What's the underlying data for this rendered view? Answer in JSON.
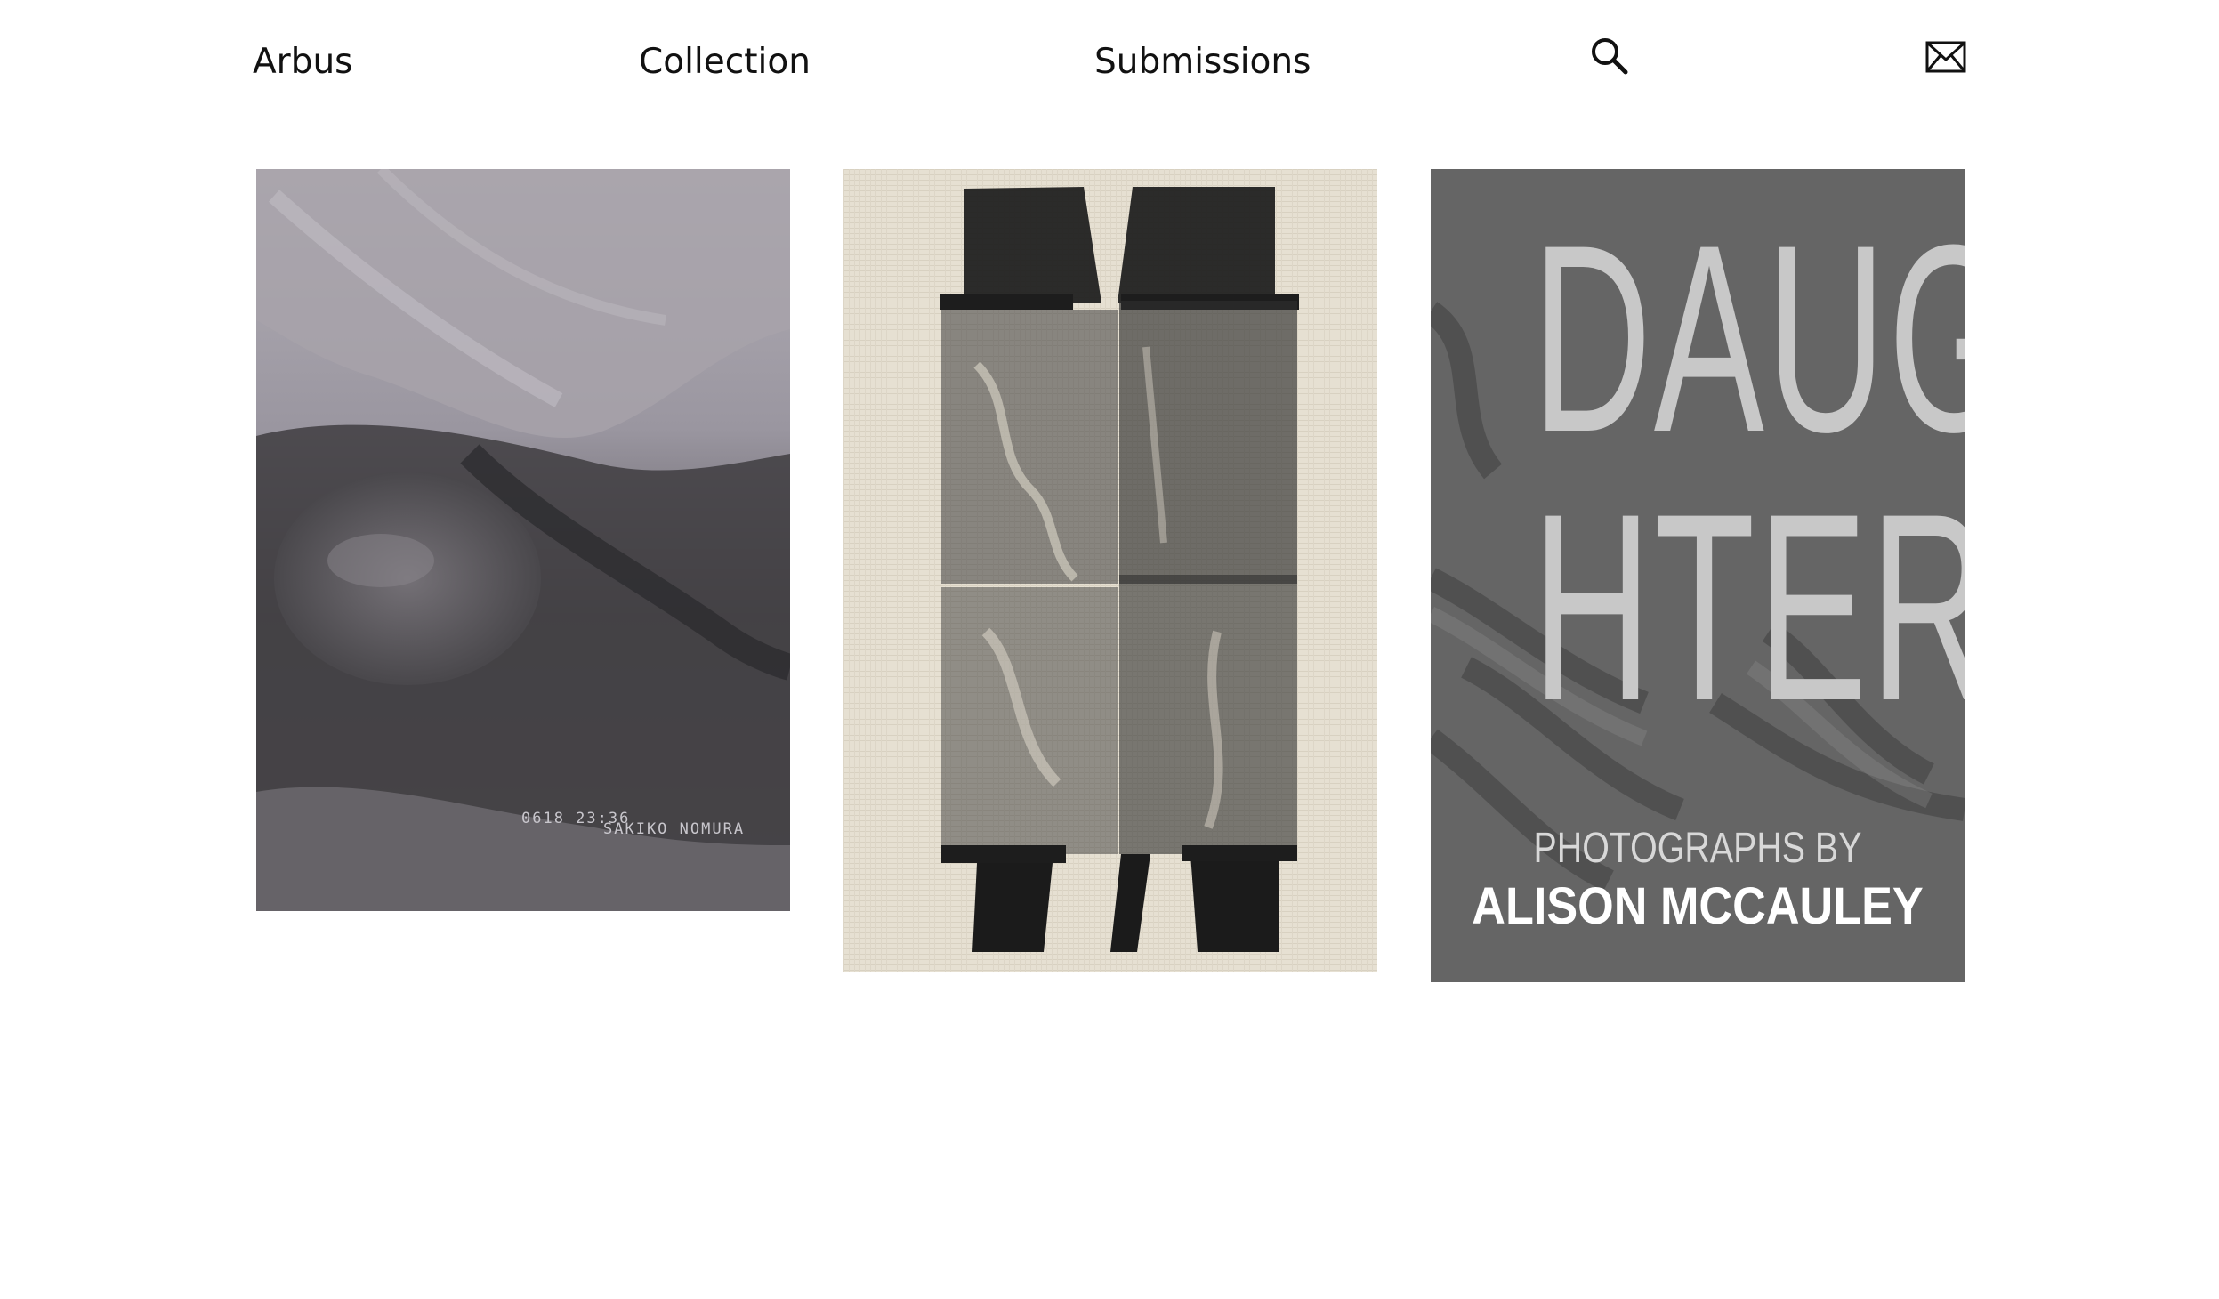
{
  "nav": {
    "home_label": "Arbus",
    "collection_label": "Collection",
    "submissions_label": "Submissions",
    "search_icon": "search-icon",
    "mail_icon": "mail-icon"
  },
  "covers": [
    {
      "caption_date": "0618 23:36",
      "caption_name": "SAKIKO NOMURA",
      "palette": "grayscale"
    },
    {
      "palette": "cream-black"
    },
    {
      "title_line_1": "DAUG",
      "title_line_2": "HTER",
      "subtitle": "PHOTOGRAPHS BY",
      "author": "ALISON MCCAULEY",
      "palette": "gray"
    }
  ],
  "colors": {
    "background": "#ffffff",
    "text": "#111111"
  }
}
